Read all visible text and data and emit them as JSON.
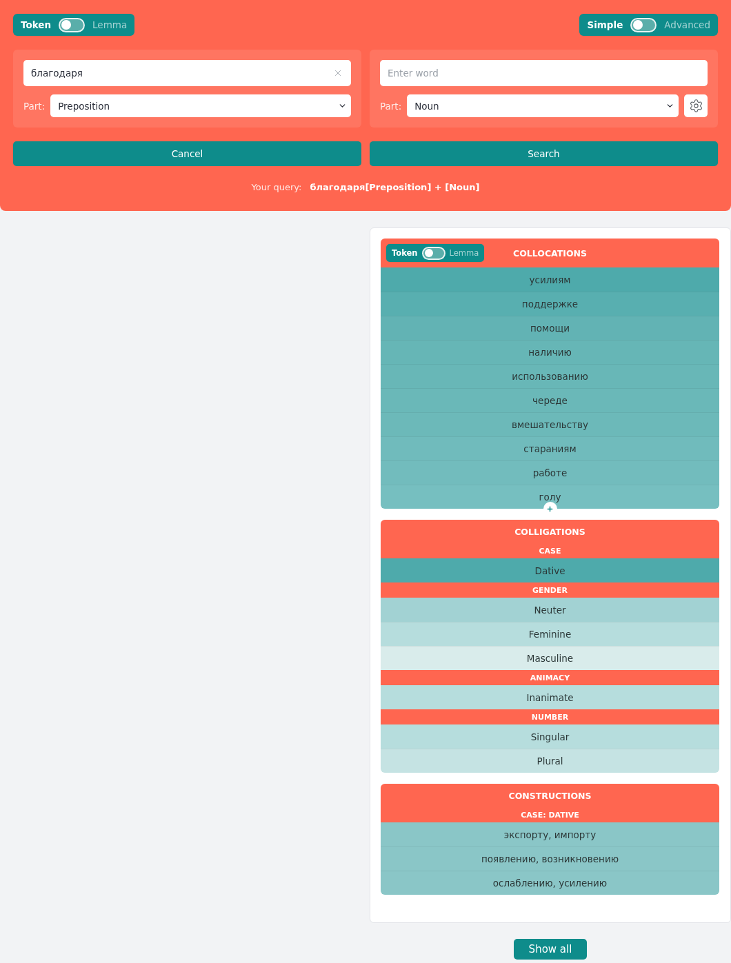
{
  "header": {
    "token_toggle": {
      "left_label": "Token",
      "right_label": "Lemma",
      "on": false
    },
    "mode_toggle": {
      "left_label": "Simple",
      "right_label": "Advanced",
      "on": false
    },
    "word_panels": [
      {
        "word_field": {
          "value": "благодаря"
        },
        "clear_button": true,
        "part_label": "Part:",
        "part_select": "Preposition",
        "settings_button": false
      },
      {
        "word_field": {
          "placeholder": "Enter word"
        },
        "clear_button": false,
        "part_label": "Part:",
        "part_select": "Noun",
        "settings_button": true
      }
    ],
    "buttons": [
      {
        "label": "Cancel"
      },
      {
        "label": "Search"
      }
    ],
    "query": {
      "label": "Your query:",
      "value": "благодаря[Preposition] + [Noun]"
    }
  },
  "results": {
    "collocations": {
      "toggle": {
        "left_label": "Token",
        "right_label": "Lemma",
        "on": false
      },
      "title": "COLLOCATIONS",
      "show_more": true,
      "rows": [
        {
          "text": "усилиям",
          "color": "#4eaaab"
        },
        {
          "text": "поддержке",
          "color": "#58afb0"
        },
        {
          "text": "помощи",
          "color": "#62b3b4"
        },
        {
          "text": "наличию",
          "color": "#66b6b6"
        },
        {
          "text": "использованию",
          "color": "#68b7b7"
        },
        {
          "text": "череде",
          "color": "#6ab8b8"
        },
        {
          "text": "вмешательству",
          "color": "#6cb9b9"
        },
        {
          "text": "стараниям",
          "color": "#70bbbc"
        },
        {
          "text": "работе",
          "color": "#72bcbd"
        },
        {
          "text": "голу",
          "color": "#76bfc0"
        }
      ]
    },
    "colligations": {
      "title": "COLLIGATIONS",
      "groups": [
        {
          "heading": "CASE",
          "rows": [
            {
              "text": "Dative",
              "color": "#4eaaab"
            }
          ]
        },
        {
          "heading": "GENDER",
          "rows": [
            {
              "text": "Neuter",
              "color": "#a2d2d3"
            },
            {
              "text": "Feminine",
              "color": "#b6dddd"
            },
            {
              "text": "Masculine",
              "color": "#d9eceb"
            }
          ]
        },
        {
          "heading": "ANIMACY",
          "rows": [
            {
              "text": "Inanimate",
              "color": "#b6dddd"
            }
          ]
        },
        {
          "heading": "NUMBER",
          "rows": [
            {
              "text": "Singular",
              "color": "#b6dddd"
            },
            {
              "text": "Plural",
              "color": "#c5e3e3"
            }
          ]
        }
      ]
    },
    "constructions": {
      "title": "CONSTRUCTIONS",
      "groups": [
        {
          "heading": "CASE: DATIVE",
          "rows": [
            {
              "text": "экспорту, импорту",
              "color": "#8ac6c7"
            },
            {
              "text": "появлению, возникновению",
              "color": "#8ac6c7"
            },
            {
              "text": "ослаблению, усилению",
              "color": "#8ac6c7"
            }
          ]
        }
      ]
    },
    "show_all": {
      "label": "Show all"
    }
  }
}
